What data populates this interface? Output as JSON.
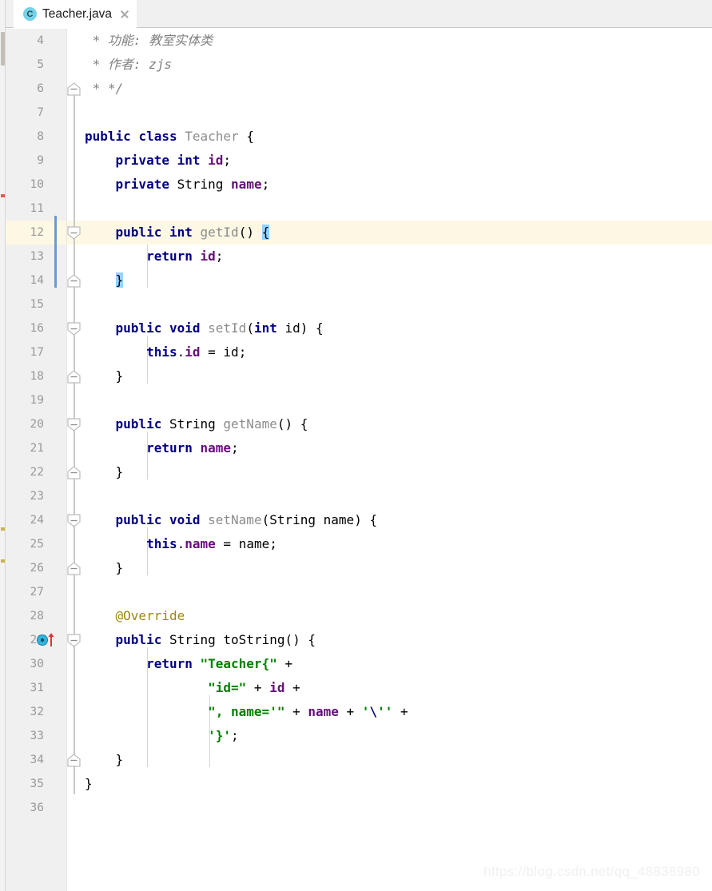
{
  "window": {
    "title": "Teacher.java"
  },
  "tab": {
    "label": "Teacher.java",
    "icon": "java-class-icon",
    "icon_letter": "C",
    "close_icon": "close-icon",
    "active": true
  },
  "colors": {
    "keyword": "#000080",
    "field": "#660e7a",
    "class_name": "#8c8c8c",
    "method_name": "#8c8c8c",
    "comment": "#808080",
    "string": "#008000",
    "annotation": "#9e880d",
    "current_line_bg": "#fdf8e3",
    "brace_match_bg": "#93d1ff",
    "gutter_bg": "#f0f0f0",
    "change_bar": "#6a9ad0",
    "tab_icon_bg": "#73d2e8",
    "editor_bg": "#ffffff"
  },
  "editor": {
    "language": "java",
    "first_visible_line": 4,
    "last_visible_line": 36,
    "current_line": 12,
    "line_numbers": [
      4,
      5,
      6,
      7,
      8,
      9,
      10,
      11,
      12,
      13,
      14,
      15,
      16,
      17,
      18,
      19,
      20,
      21,
      22,
      23,
      24,
      25,
      26,
      27,
      28,
      29,
      30,
      31,
      32,
      33,
      34,
      35,
      36
    ],
    "lines": [
      {
        "n": 4,
        "text": " * 功能: 教室实体类"
      },
      {
        "n": 5,
        "text": " * 作者: zjs"
      },
      {
        "n": 6,
        "text": " * */"
      },
      {
        "n": 7,
        "text": ""
      },
      {
        "n": 8,
        "text": "public class Teacher {"
      },
      {
        "n": 9,
        "text": "    private int id;"
      },
      {
        "n": 10,
        "text": "    private String name;"
      },
      {
        "n": 11,
        "text": ""
      },
      {
        "n": 12,
        "text": "    public int getId() {"
      },
      {
        "n": 13,
        "text": "        return id;"
      },
      {
        "n": 14,
        "text": "    }"
      },
      {
        "n": 15,
        "text": ""
      },
      {
        "n": 16,
        "text": "    public void setId(int id) {"
      },
      {
        "n": 17,
        "text": "        this.id = id;"
      },
      {
        "n": 18,
        "text": "    }"
      },
      {
        "n": 19,
        "text": ""
      },
      {
        "n": 20,
        "text": "    public String getName() {"
      },
      {
        "n": 21,
        "text": "        return name;"
      },
      {
        "n": 22,
        "text": "    }"
      },
      {
        "n": 23,
        "text": ""
      },
      {
        "n": 24,
        "text": "    public void setName(String name) {"
      },
      {
        "n": 25,
        "text": "        this.name = name;"
      },
      {
        "n": 26,
        "text": "    }"
      },
      {
        "n": 27,
        "text": ""
      },
      {
        "n": 28,
        "text": "    @Override"
      },
      {
        "n": 29,
        "text": "    public String toString() {"
      },
      {
        "n": 30,
        "text": "        return \"Teacher{\" +"
      },
      {
        "n": 31,
        "text": "                \"id=\" + id +"
      },
      {
        "n": 32,
        "text": "                \", name='\" + name + '\\'' +"
      },
      {
        "n": 33,
        "text": "                '}';"
      },
      {
        "n": 34,
        "text": "    }"
      },
      {
        "n": 35,
        "text": "}"
      },
      {
        "n": 36,
        "text": ""
      }
    ],
    "gutter_icons": [
      {
        "line": 29,
        "name": "override-method-icon",
        "description": "implementing/overriding method marker"
      }
    ]
  },
  "watermark": {
    "text": "https://blog.csdn.net/qq_48838980"
  }
}
